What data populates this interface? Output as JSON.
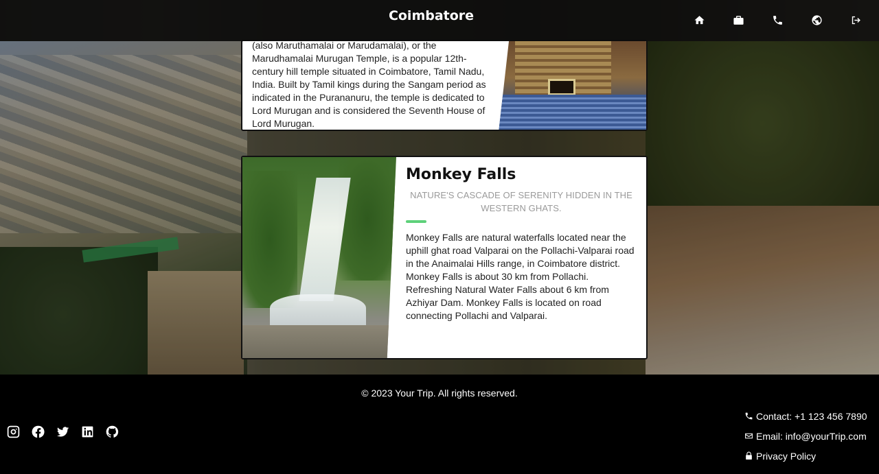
{
  "header": {
    "brand": "Coimbatore",
    "nav": [
      {
        "icon": "home-icon"
      },
      {
        "icon": "briefcase-icon"
      },
      {
        "icon": "phone-icon"
      },
      {
        "icon": "globe-icon"
      },
      {
        "icon": "logout-icon"
      }
    ]
  },
  "cards": {
    "temple": {
      "description": "(also Maruthamalai or Marudamalai), or the Marudhamalai Murugan Temple, is a popular 12th-century hill temple situated in Coimbatore, Tamil Nadu, India. Built by Tamil kings during the Sangam period as indicated in the Purananuru, the temple is dedicated to Lord Murugan and is considered the Seventh House of Lord Murugan."
    },
    "monkey_falls": {
      "title": "Monkey Falls",
      "subtitle": "Nature's cascade of serenity hidden in the Western Ghats.",
      "description": "Monkey Falls are natural waterfalls located near the uphill ghat road Valparai on the Pollachi-Valparai road in the Anaimalai Hills range, in Coimbatore district. Monkey Falls is about 30 km from Pollachi. Refreshing Natural Water Falls about 6 km from Azhiyar Dam. Monkey Falls is located on road connecting Pollachi and Valparai."
    }
  },
  "footer": {
    "copyright": "© 2023 Your Trip. All rights reserved.",
    "social": [
      "instagram-icon",
      "facebook-icon",
      "twitter-icon",
      "linkedin-icon",
      "github-icon"
    ],
    "contact_phone": "Contact: +1 123 456 7890",
    "contact_email": "Email: info@yourTrip.com",
    "privacy": "Privacy Policy"
  },
  "colors": {
    "accent": "#5ed17a",
    "header_bg": "#0c0c0c",
    "footer_bg": "#000000"
  }
}
